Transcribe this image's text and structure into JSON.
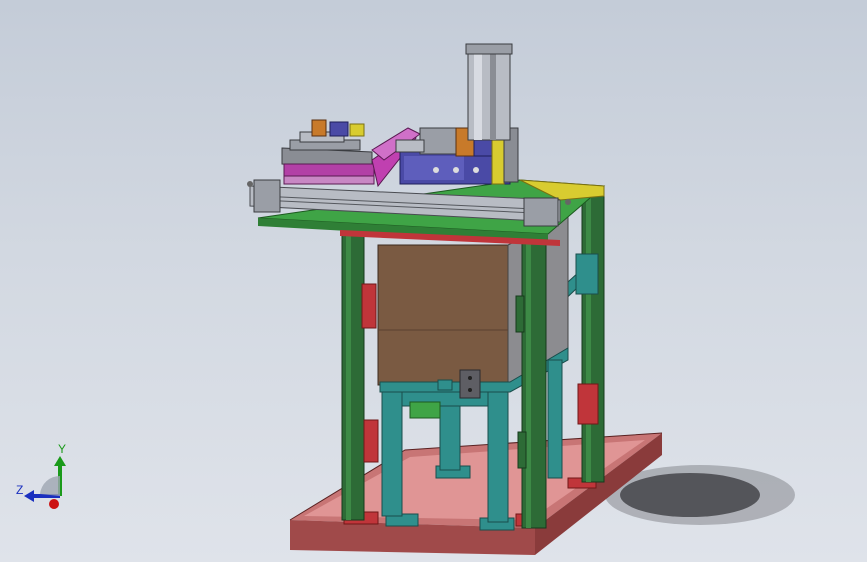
{
  "viewport": {
    "background_top": "#c4ccd8",
    "background_bottom": "#dfe3ea"
  },
  "triad": {
    "x_label": "",
    "y_label": "Y",
    "z_label": "Z",
    "x_color": "#cc1111",
    "y_color": "#1a9a1a",
    "z_color": "#1a2fbf"
  },
  "model": {
    "base_plate_color": "#b05a5a",
    "frame_post_color": "#2d6b36",
    "stand_color": "#2f8f8c",
    "box_color": "#7a5a42",
    "pad_color": "#c0353a",
    "accent_magenta": "#c040b0",
    "accent_yellow": "#d8cc30",
    "accent_blue": "#4a4aa6"
  }
}
